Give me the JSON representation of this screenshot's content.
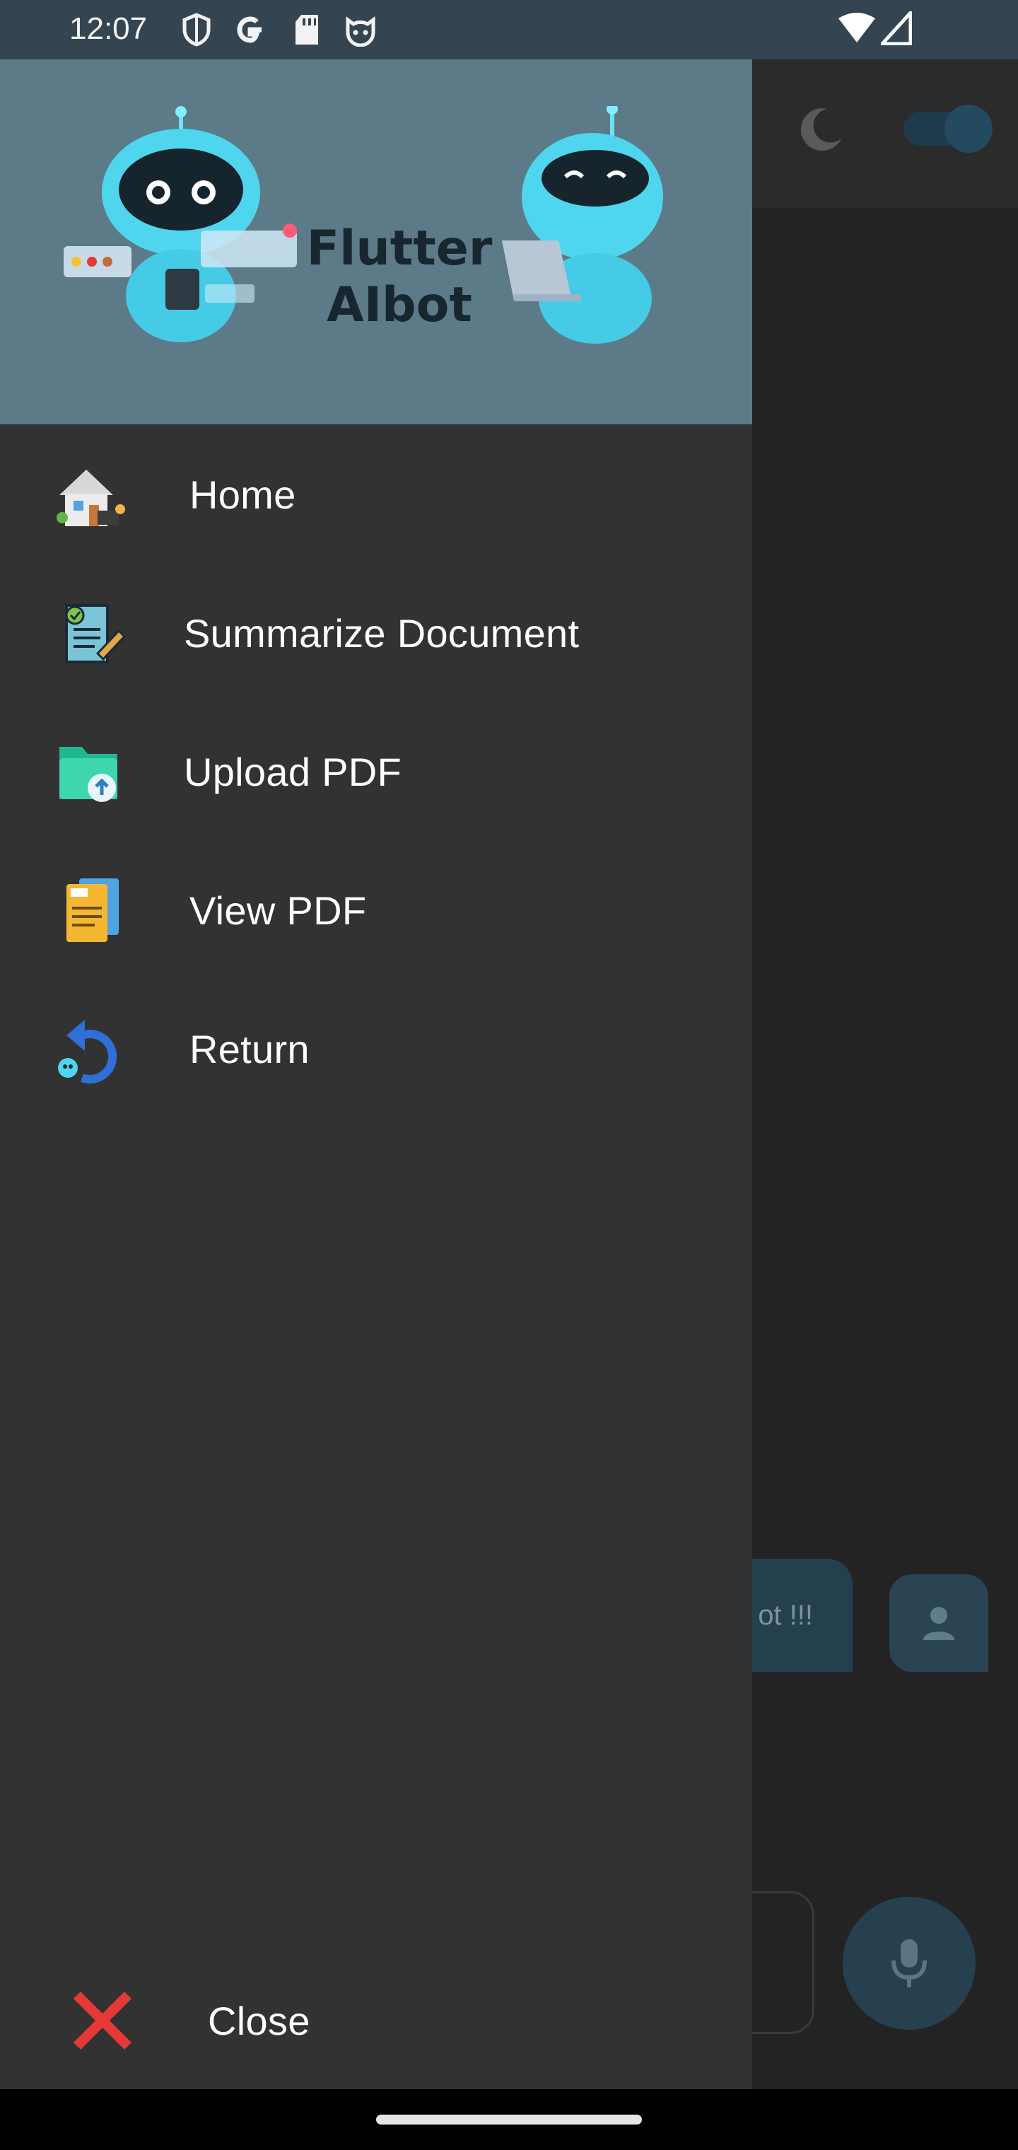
{
  "status_bar": {
    "time": "12:07",
    "left_icons": [
      "shield-icon",
      "google-icon",
      "sd-card-icon",
      "android-cat-icon"
    ],
    "right_icons": [
      "wifi-icon",
      "cellular-signal-icon"
    ]
  },
  "drawer": {
    "header": {
      "logo_line1": "Flutter",
      "logo_line2": "AIbot"
    },
    "items": [
      {
        "label": "Home",
        "icon": "house-icon"
      },
      {
        "label": "Summarize Document",
        "icon": "document-edit-icon"
      },
      {
        "label": "Upload PDF",
        "icon": "folder-upload-icon"
      },
      {
        "label": "View PDF",
        "icon": "file-icon"
      },
      {
        "label": "Return",
        "icon": "return-arrow-icon"
      }
    ],
    "close": {
      "label": "Close",
      "icon": "close-x-icon"
    }
  },
  "background": {
    "chat_bubble_text": "ot  !!!",
    "theme_toggle_icon": "moon-icon",
    "send_button_icon": "microphone-icon",
    "user_avatar_icon": "person-icon"
  },
  "colors": {
    "drawer_bg": "#323232",
    "header_bg": "#5c7a88",
    "status_bar_bg": "#344551",
    "accent": "#2a4454",
    "close_red": "#e53935"
  }
}
